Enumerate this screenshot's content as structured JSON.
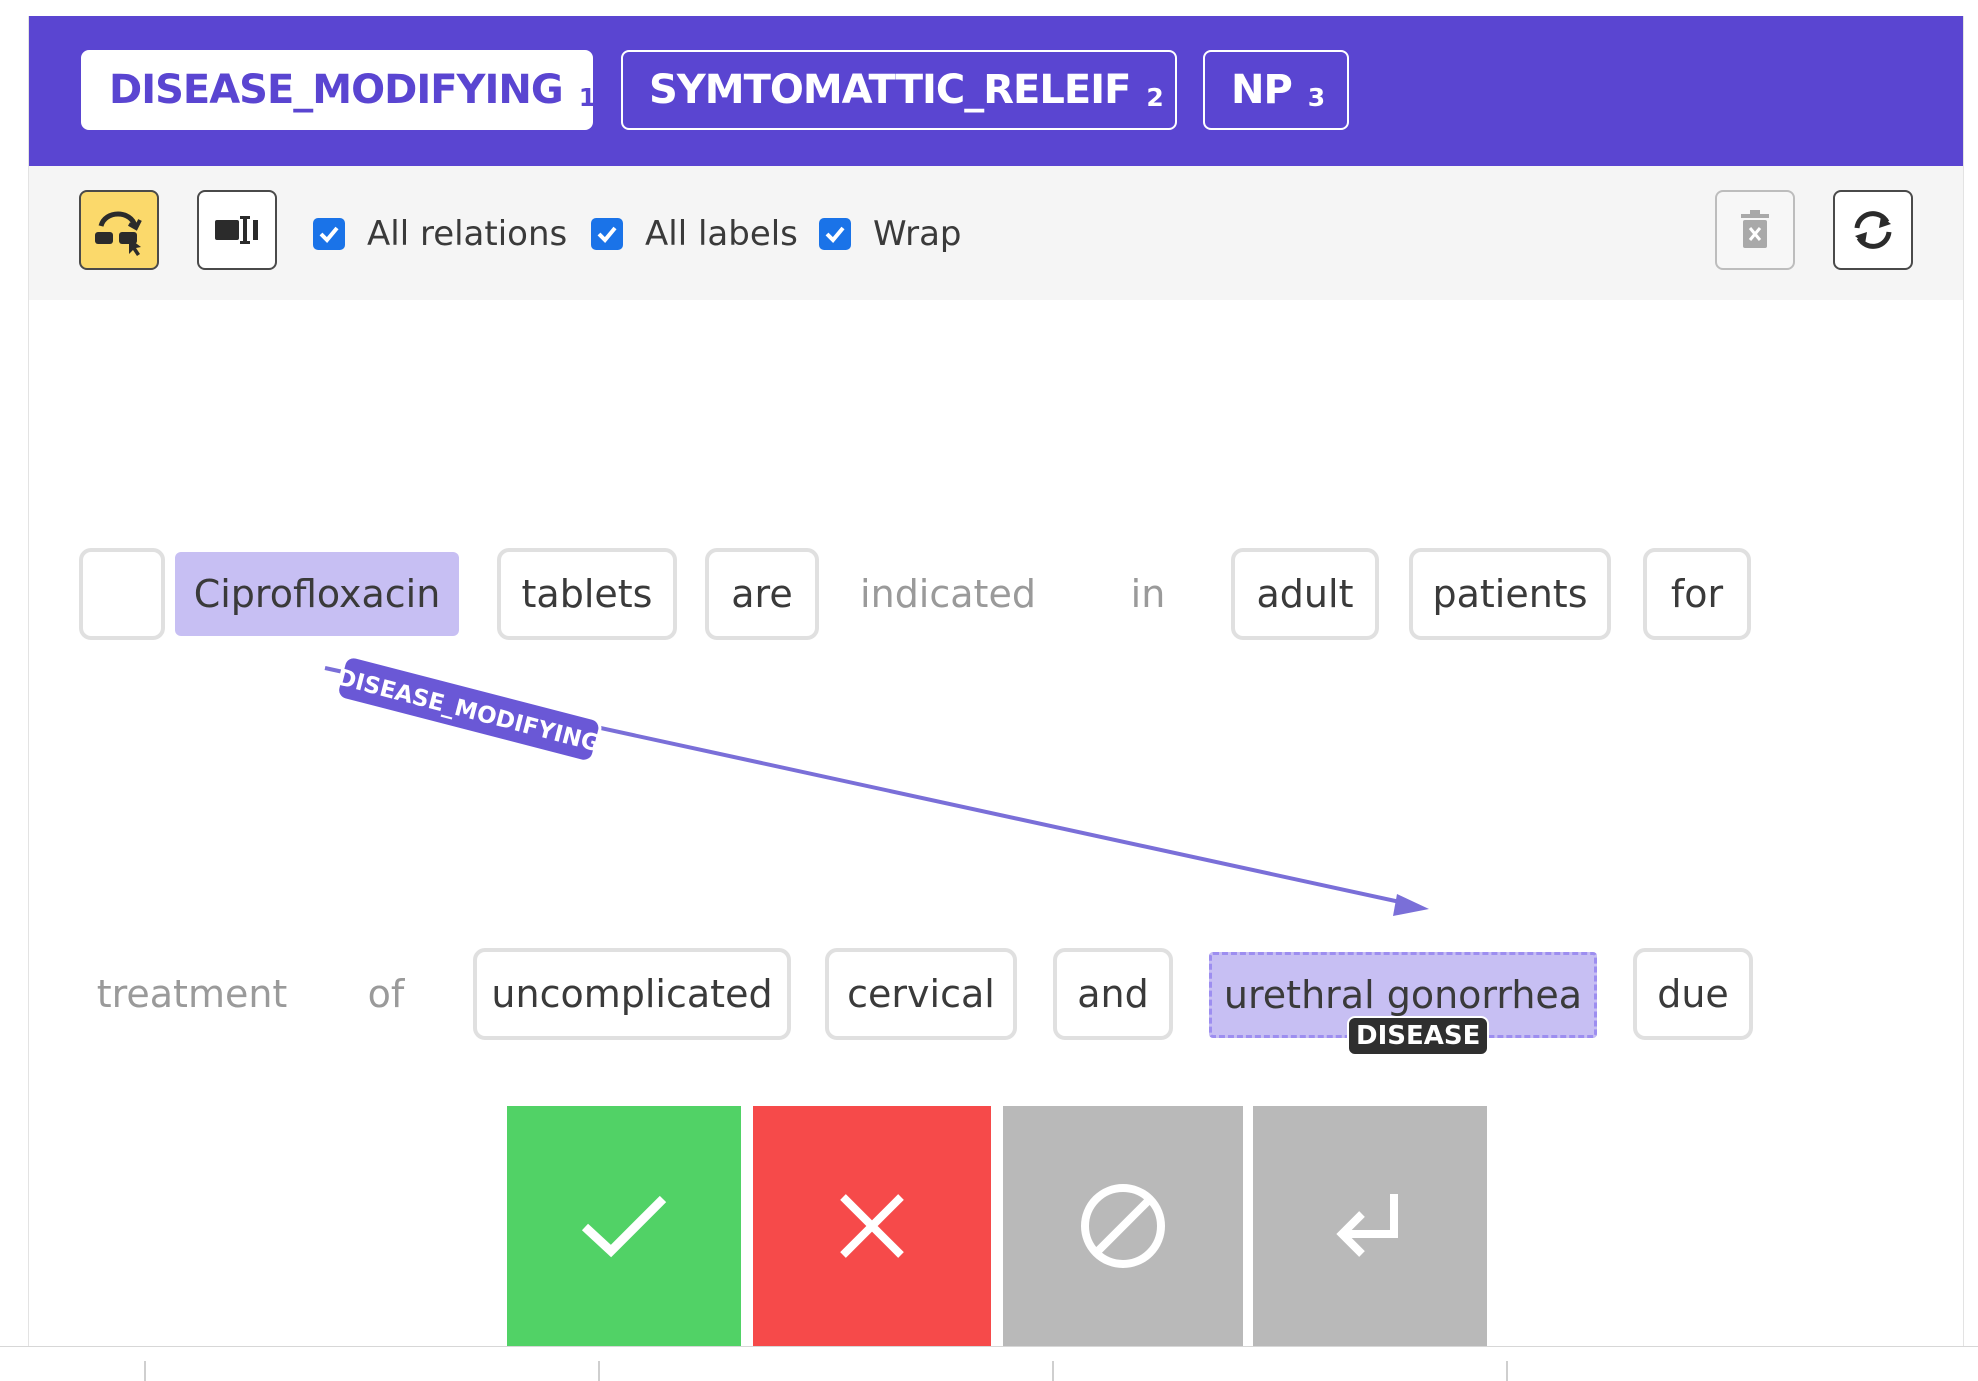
{
  "relation_labels": [
    {
      "label": "DISEASE_MODIFYING",
      "hotkey": "1",
      "active": true
    },
    {
      "label": "SYMTOMATTIC_RELEIF",
      "hotkey": "2",
      "active": false
    },
    {
      "label": "NP",
      "hotkey": "3",
      "active": false
    }
  ],
  "toolbar": {
    "relation_mode_icon": "relation-mode-icon",
    "span_select_icon": "span-select-icon",
    "checkboxes": [
      {
        "label": "All relations",
        "checked": true
      },
      {
        "label": "All labels",
        "checked": true
      },
      {
        "label": "Wrap",
        "checked": true
      }
    ],
    "delete_icon": "trash-icon",
    "refresh_icon": "refresh-icon"
  },
  "tokens": {
    "line1": [
      {
        "text": ""
      },
      {
        "text": "Ciprofloxacin",
        "entity": true
      },
      {
        "text": "tablets"
      },
      {
        "text": "are"
      },
      {
        "text": "indicated"
      },
      {
        "text": "in"
      },
      {
        "text": "adult"
      },
      {
        "text": "patients"
      },
      {
        "text": "for"
      }
    ],
    "line2": [
      {
        "text": "treatment"
      },
      {
        "text": "of"
      },
      {
        "text": "uncomplicated"
      },
      {
        "text": "cervical"
      },
      {
        "text": "and"
      },
      {
        "text": "urethral gonorrhea",
        "entity": true,
        "tag": "DISEASE"
      },
      {
        "text": "due"
      }
    ]
  },
  "relation": {
    "label": "DISEASE_MODIFYING",
    "from": "Ciprofloxacin",
    "to": "urethral gonorrhea"
  },
  "actions": [
    {
      "name": "accept",
      "icon": "check-icon",
      "color": "#51d266"
    },
    {
      "name": "reject",
      "icon": "x-icon",
      "color": "#f64a4a"
    },
    {
      "name": "skip",
      "icon": "ban-icon",
      "color": "#b9b9b9"
    },
    {
      "name": "next",
      "icon": "enter-arrow-icon",
      "color": "#b9b9b9"
    }
  ]
}
